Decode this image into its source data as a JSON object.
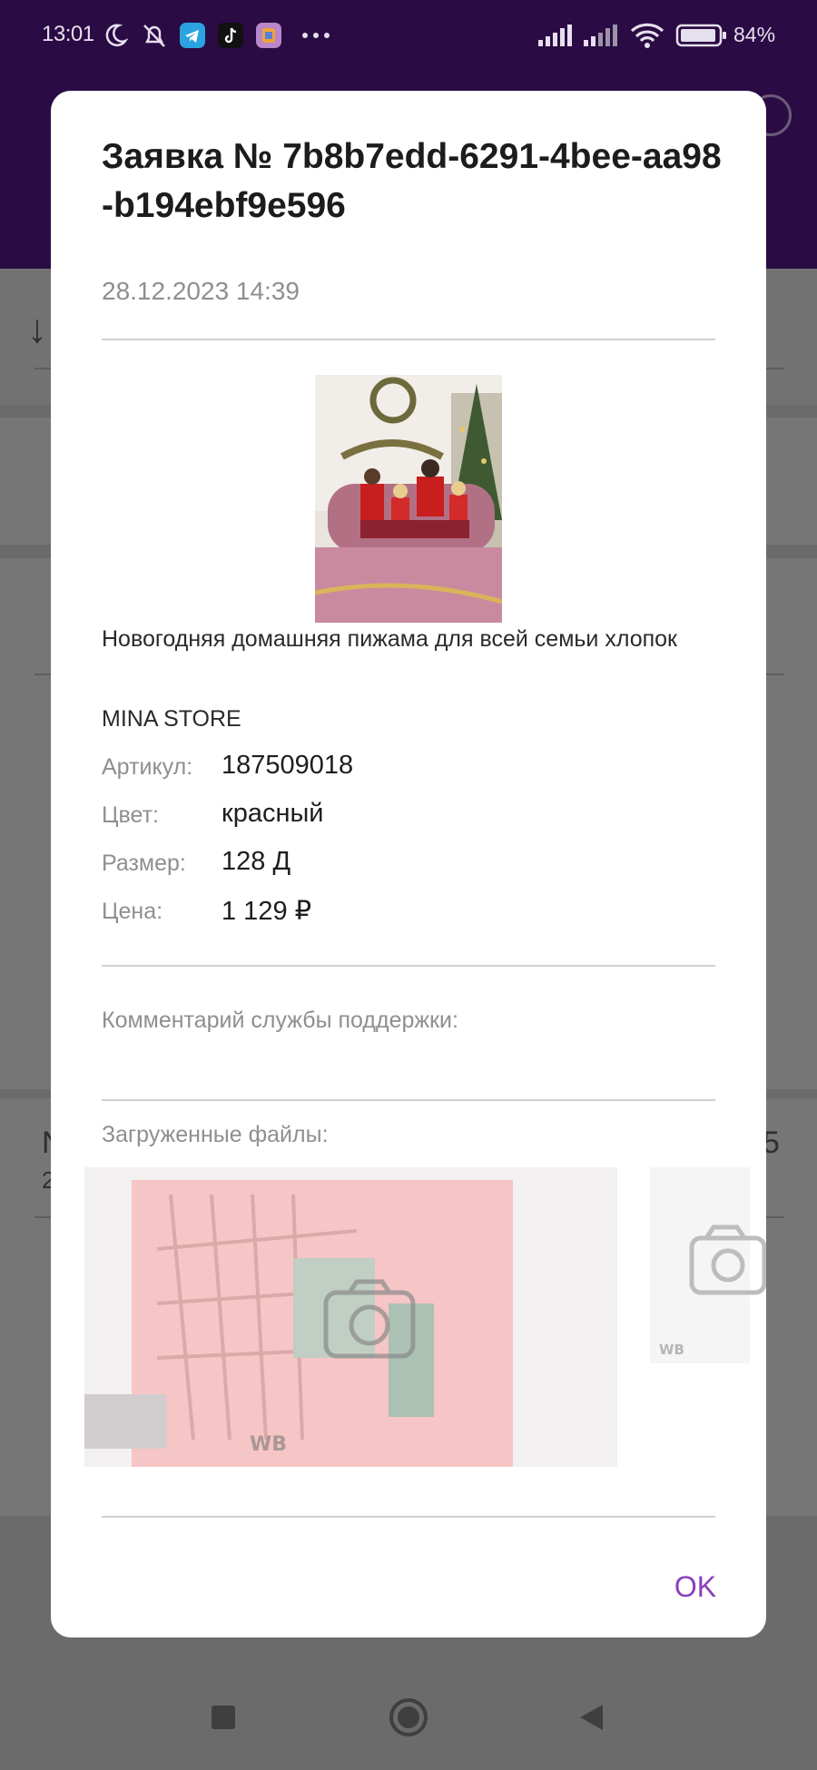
{
  "status_bar": {
    "time": "13:01",
    "battery": "84%",
    "icons": [
      "moon-icon",
      "bell-off-icon",
      "telegram-icon",
      "tiktok-icon",
      "app-icon",
      "more-icon",
      "signal-icon",
      "signal-icon",
      "wifi-icon",
      "battery-icon"
    ]
  },
  "dialog": {
    "title": "Заявка № 7b8b7edd-6291-4bee-aa98-b194ebf9e596",
    "date": "28.12.2023 14:39",
    "product": {
      "name": "Новогодняя домашняя пижама для всей семьи хлопок",
      "brand": "MINA STORE",
      "fields": [
        {
          "label": "Артикул:",
          "value": "187509018"
        },
        {
          "label": "Цвет:",
          "value": "красный"
        },
        {
          "label": "Размер:",
          "value": "128 Д"
        },
        {
          "label": "Цена:",
          "value": "1 129 ₽"
        }
      ]
    },
    "support_comment_label": "Комментарий службы поддержки:",
    "support_comment": "",
    "files_label": "Загруженные файлы:",
    "file_watermark": "WB",
    "ok_label": "OK"
  },
  "colors": {
    "header": "#2a0b44",
    "accent": "#8a3fbd",
    "scrim": "#6b6b6b"
  }
}
